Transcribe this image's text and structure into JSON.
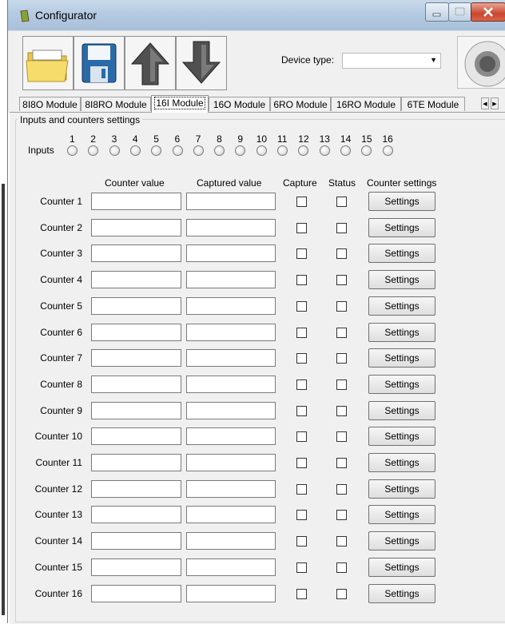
{
  "window": {
    "title": "Configurator"
  },
  "toolbar": {
    "device_type_label": "Device type:",
    "device_type_value": "",
    "icons": [
      "open-folder-icon",
      "save-icon",
      "upload-arrow-icon",
      "download-arrow-icon",
      "connect-icon"
    ]
  },
  "tabs": [
    {
      "label": "8I8O Module"
    },
    {
      "label": "8I8RO Module"
    },
    {
      "label": "16I Module",
      "active": true
    },
    {
      "label": "16O Module"
    },
    {
      "label": "6RO Module"
    },
    {
      "label": "16RO Module"
    },
    {
      "label": "6TE Module"
    }
  ],
  "group": {
    "title": "Inputs and counters settings"
  },
  "inputs": {
    "label": "Inputs",
    "numbers": [
      "1",
      "2",
      "3",
      "4",
      "5",
      "6",
      "7",
      "8",
      "9",
      "10",
      "11",
      "12",
      "13",
      "14",
      "15",
      "16"
    ]
  },
  "columns": {
    "counter_value": "Counter value",
    "captured_value": "Captured value",
    "capture": "Capture",
    "status": "Status",
    "counter_settings": "Counter settings"
  },
  "counters": [
    {
      "label": "Counter 1",
      "counter_value": "",
      "captured_value": "",
      "capture": false,
      "status": false,
      "settings": "Settings"
    },
    {
      "label": "Counter 2",
      "counter_value": "",
      "captured_value": "",
      "capture": false,
      "status": false,
      "settings": "Settings"
    },
    {
      "label": "Counter 3",
      "counter_value": "",
      "captured_value": "",
      "capture": false,
      "status": false,
      "settings": "Settings"
    },
    {
      "label": "Counter 4",
      "counter_value": "",
      "captured_value": "",
      "capture": false,
      "status": false,
      "settings": "Settings"
    },
    {
      "label": "Counter 5",
      "counter_value": "",
      "captured_value": "",
      "capture": false,
      "status": false,
      "settings": "Settings"
    },
    {
      "label": "Counter 6",
      "counter_value": "",
      "captured_value": "",
      "capture": false,
      "status": false,
      "settings": "Settings"
    },
    {
      "label": "Counter 7",
      "counter_value": "",
      "captured_value": "",
      "capture": false,
      "status": false,
      "settings": "Settings"
    },
    {
      "label": "Counter 8",
      "counter_value": "",
      "captured_value": "",
      "capture": false,
      "status": false,
      "settings": "Settings"
    },
    {
      "label": "Counter 9",
      "counter_value": "",
      "captured_value": "",
      "capture": false,
      "status": false,
      "settings": "Settings"
    },
    {
      "label": "Counter 10",
      "counter_value": "",
      "captured_value": "",
      "capture": false,
      "status": false,
      "settings": "Settings"
    },
    {
      "label": "Counter 11",
      "counter_value": "",
      "captured_value": "",
      "capture": false,
      "status": false,
      "settings": "Settings"
    },
    {
      "label": "Counter 12",
      "counter_value": "",
      "captured_value": "",
      "capture": false,
      "status": false,
      "settings": "Settings"
    },
    {
      "label": "Counter 13",
      "counter_value": "",
      "captured_value": "",
      "capture": false,
      "status": false,
      "settings": "Settings"
    },
    {
      "label": "Counter 14",
      "counter_value": "",
      "captured_value": "",
      "capture": false,
      "status": false,
      "settings": "Settings"
    },
    {
      "label": "Counter 15",
      "counter_value": "",
      "captured_value": "",
      "capture": false,
      "status": false,
      "settings": "Settings"
    },
    {
      "label": "Counter 16",
      "counter_value": "",
      "captured_value": "",
      "capture": false,
      "status": false,
      "settings": "Settings"
    }
  ]
}
